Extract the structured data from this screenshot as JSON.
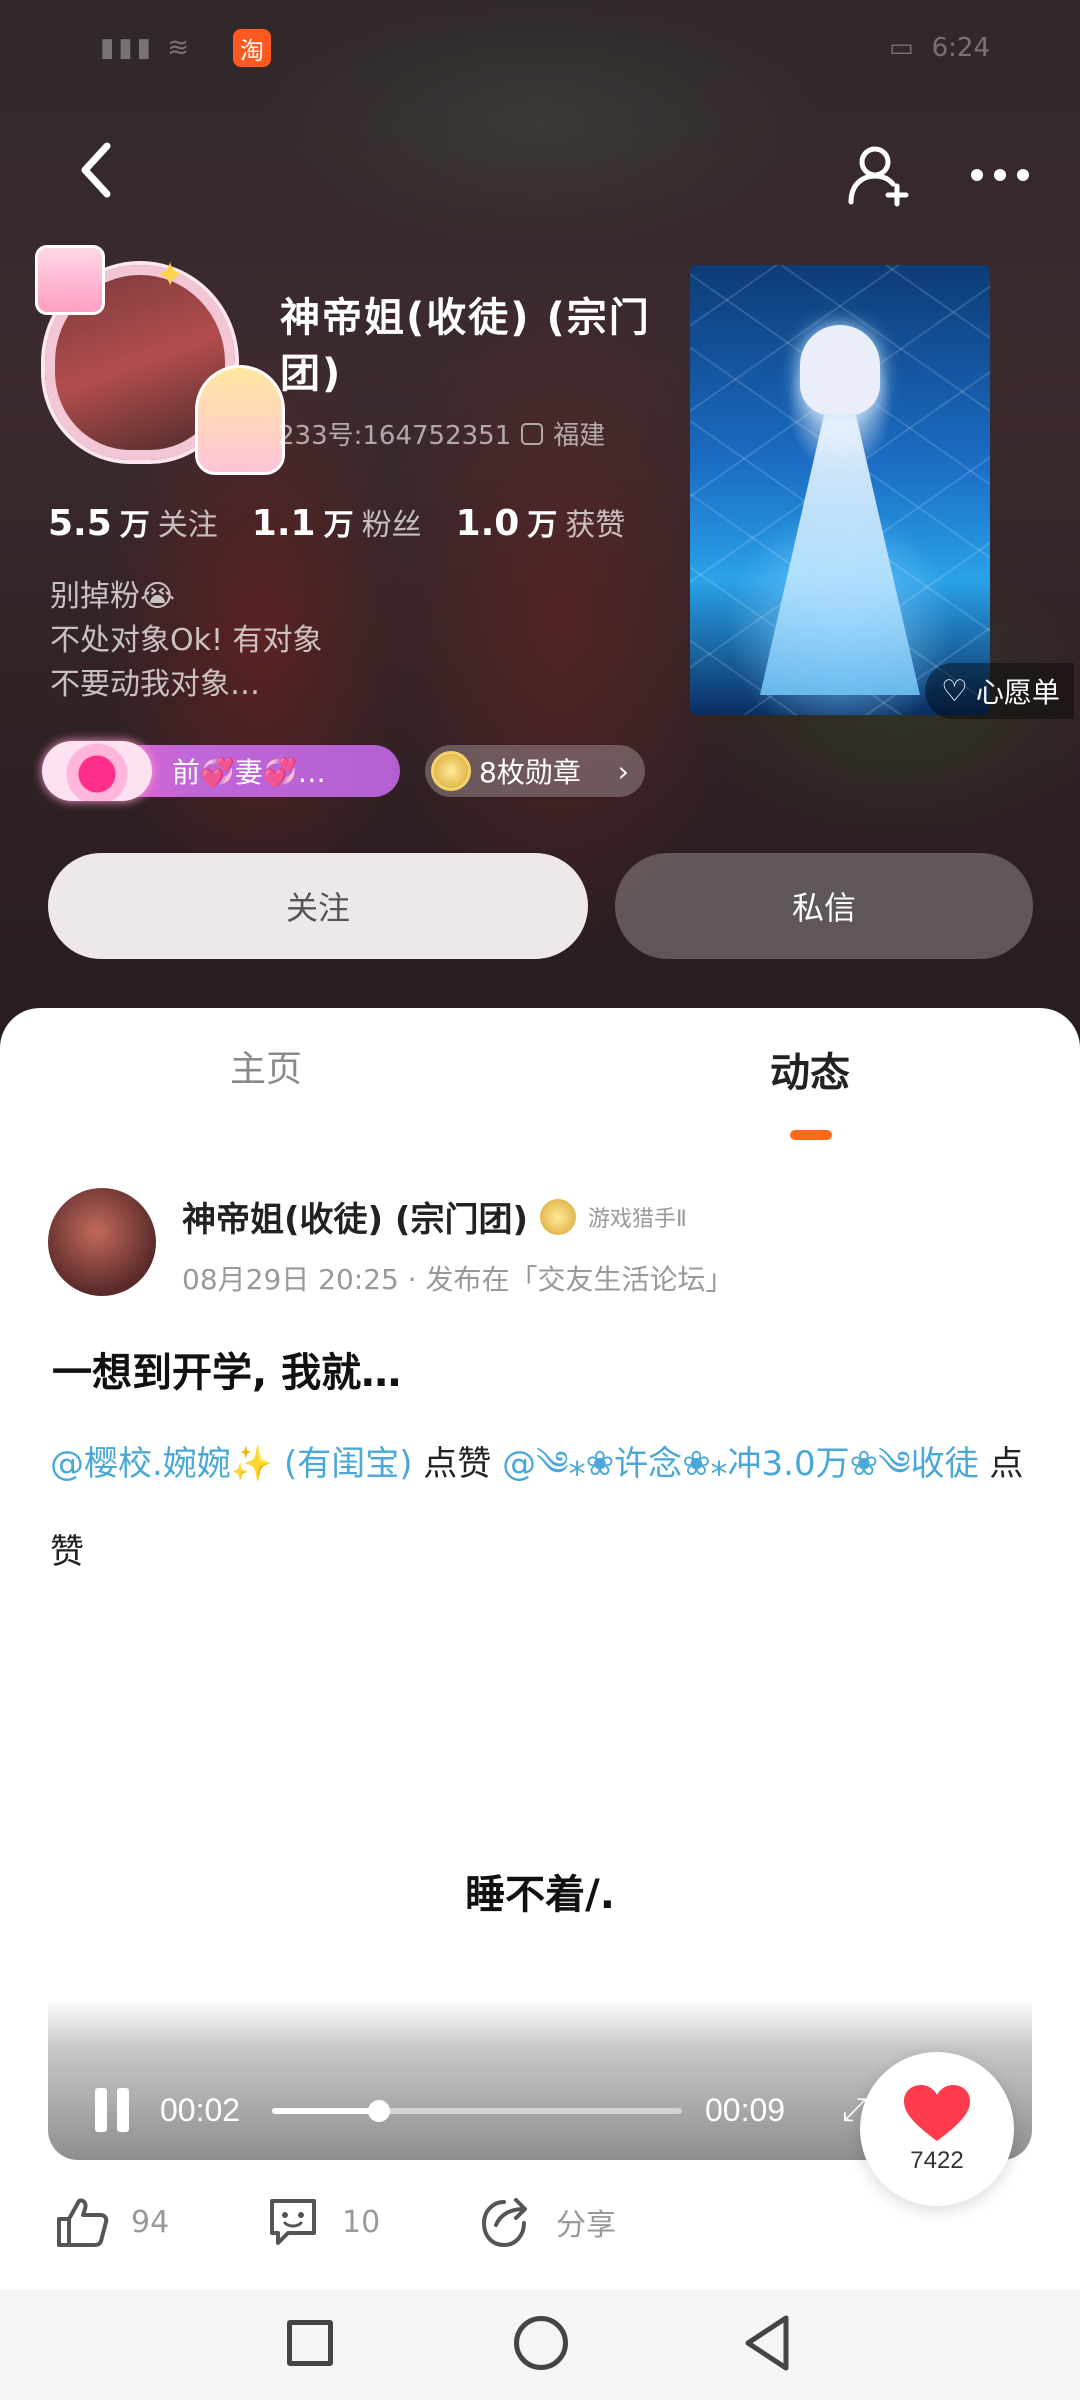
{
  "status_bar": {
    "app_badge": "淘",
    "signal": "▮▮▮ ≋",
    "battery": "▭",
    "time": "6:24"
  },
  "profile": {
    "name": "神帝姐(收徒) (宗门团)",
    "id_text": "233号:164752351",
    "location": "福建",
    "stats": [
      {
        "num": "5.5",
        "unit": "万",
        "label": "关注"
      },
      {
        "num": "1.1",
        "unit": "万",
        "label": "粉丝"
      },
      {
        "num": "1.0",
        "unit": "万",
        "label": "获赞"
      }
    ],
    "bio_lines": [
      "别掉粉😭",
      "不处对象Ok!  有对象",
      "不要动我对象…"
    ],
    "wish_label": "心愿单",
    "relation_badge": "前💞妻💞…",
    "medal_badge": "8枚勋章",
    "follow_label": "关注",
    "message_label": "私信"
  },
  "tabs": [
    {
      "label": "主页",
      "active": false
    },
    {
      "label": "动态",
      "active": true
    }
  ],
  "post": {
    "author": "神帝姐(收徒) (宗门团)",
    "author_tag": "游戏猎手Ⅱ",
    "meta": "08月29日 20:25 · 发布在「交友生活论坛」",
    "title": "一想到开学, 我就…",
    "mention_1": "@樱校.婉婉✨ (有闺宝)",
    "like_1": " 点赞 ",
    "mention_2": "@༄⁎❀许念❀⁎冲3.0万❀༄收徒",
    "like_2": " 点赞",
    "video_subtitle": "睡不着/."
  },
  "player": {
    "current_time": "00:02",
    "total_time": "00:09",
    "progress_fraction": 0.26,
    "like_count": "7422"
  },
  "actions": {
    "like_count": "94",
    "comment_count": "10",
    "share_label": "分享"
  },
  "colors": {
    "accent": "#ff6a1a",
    "mention": "#4aa8d8",
    "heart": "#ff3b4e"
  }
}
